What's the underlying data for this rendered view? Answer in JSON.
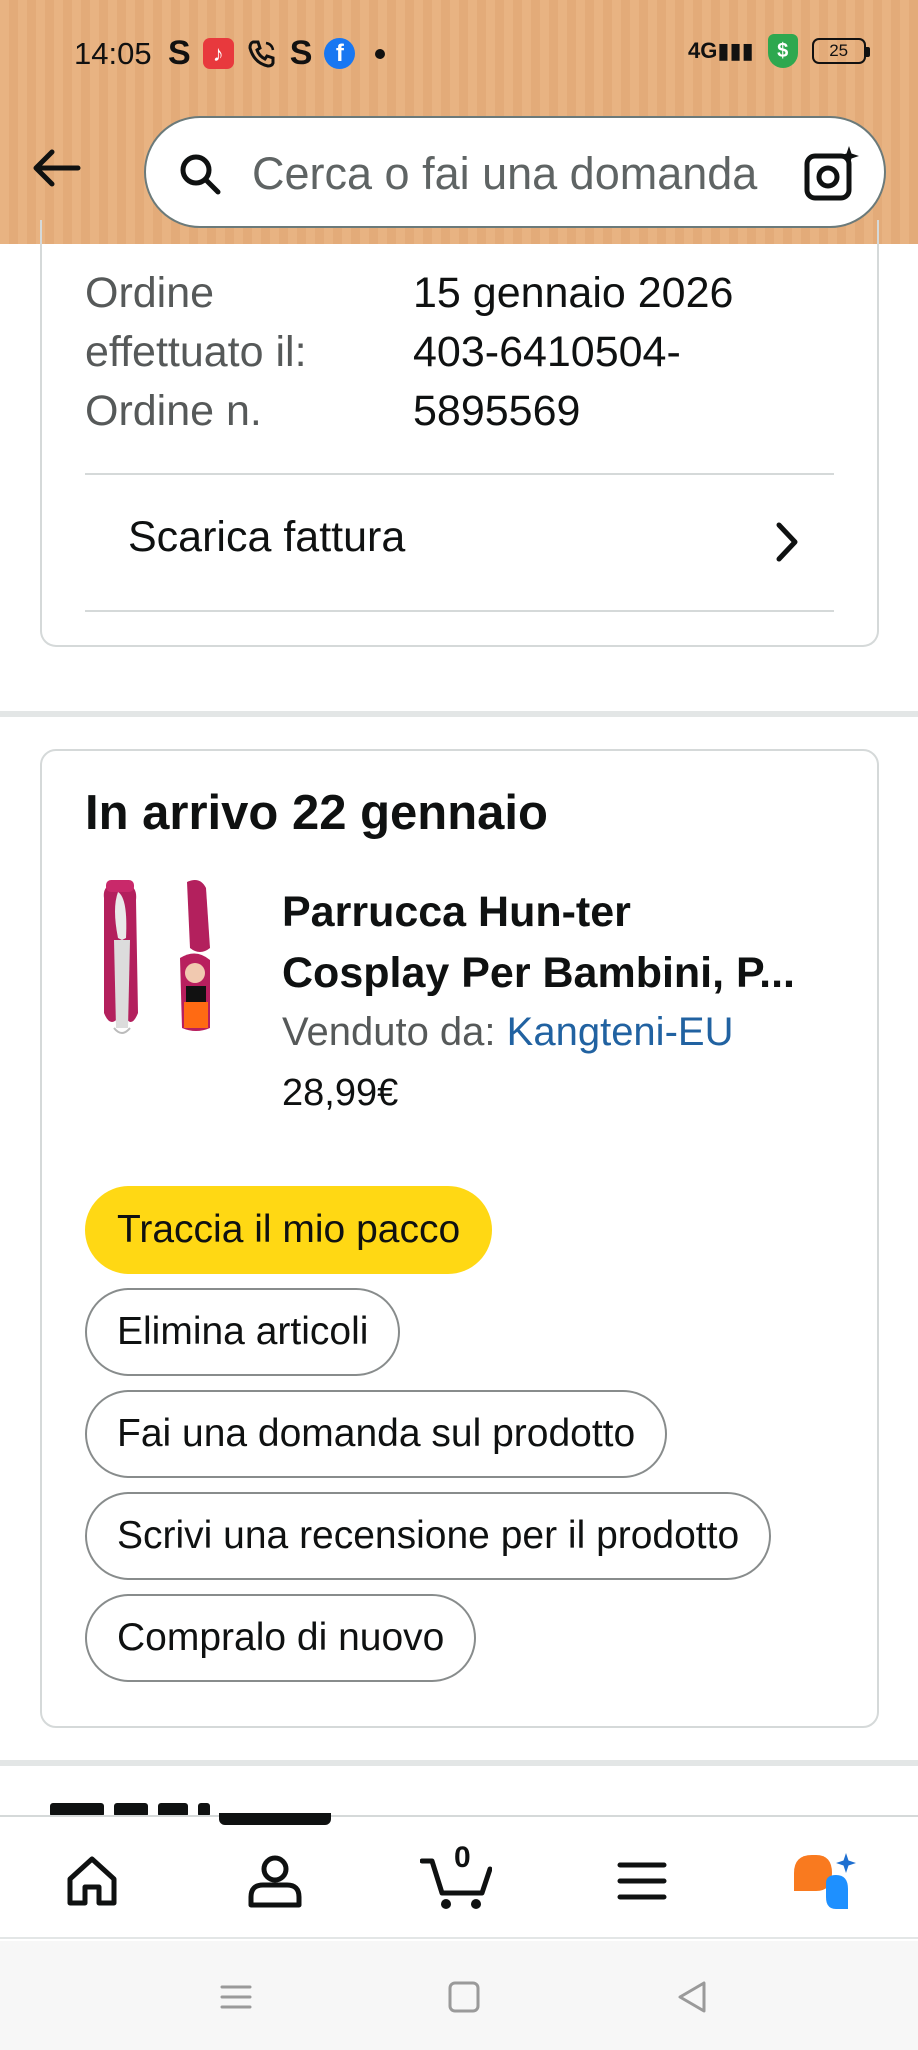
{
  "status_bar": {
    "time": "14:05",
    "app_icons": [
      "S",
      "music-icon",
      "phone-icon",
      "S",
      "facebook-icon"
    ],
    "signal": "4G",
    "battery": "25"
  },
  "header": {
    "search": {
      "placeholder": "Cerca o fai una domanda"
    },
    "bg_color": "#e8b382"
  },
  "order_summary": {
    "date_label": "Ordine effettuato il:",
    "date_label_line1": "Ordine",
    "date_label_line2": "effettuato il:",
    "date_value": "15 gennaio 2026",
    "number_label": "Ordine n.",
    "number_value_line1": "403-6410504-",
    "number_value_line2": "5895569",
    "invoice_label": "Scarica fattura"
  },
  "shipment": {
    "arrival": "In arrivo 22 gennaio",
    "product": {
      "title_line1": "Parrucca Hun-ter",
      "title_line2": "Cosplay Per Bambini, P...",
      "seller_prefix": "Venduto da: ",
      "seller_name": "Kangteni-EU",
      "price": "28,99€"
    },
    "actions": {
      "track": "Traccia il mio pacco",
      "delete": "Elimina articoli",
      "ask": "Fai una domanda sul prodotto",
      "review": "Scrivi una recensione per il prodotto",
      "buy_again": "Compralo di nuovo"
    }
  },
  "bottom_nav": {
    "items": [
      "home-icon",
      "account-icon",
      "cart-icon",
      "menu-icon",
      "rufus-icon"
    ],
    "cart_count": "0"
  },
  "colors": {
    "accent_yellow": "#ffd814",
    "link_blue": "#2162a1",
    "rufus_orange": "#f97a1f",
    "rufus_blue": "#1e90ff"
  }
}
